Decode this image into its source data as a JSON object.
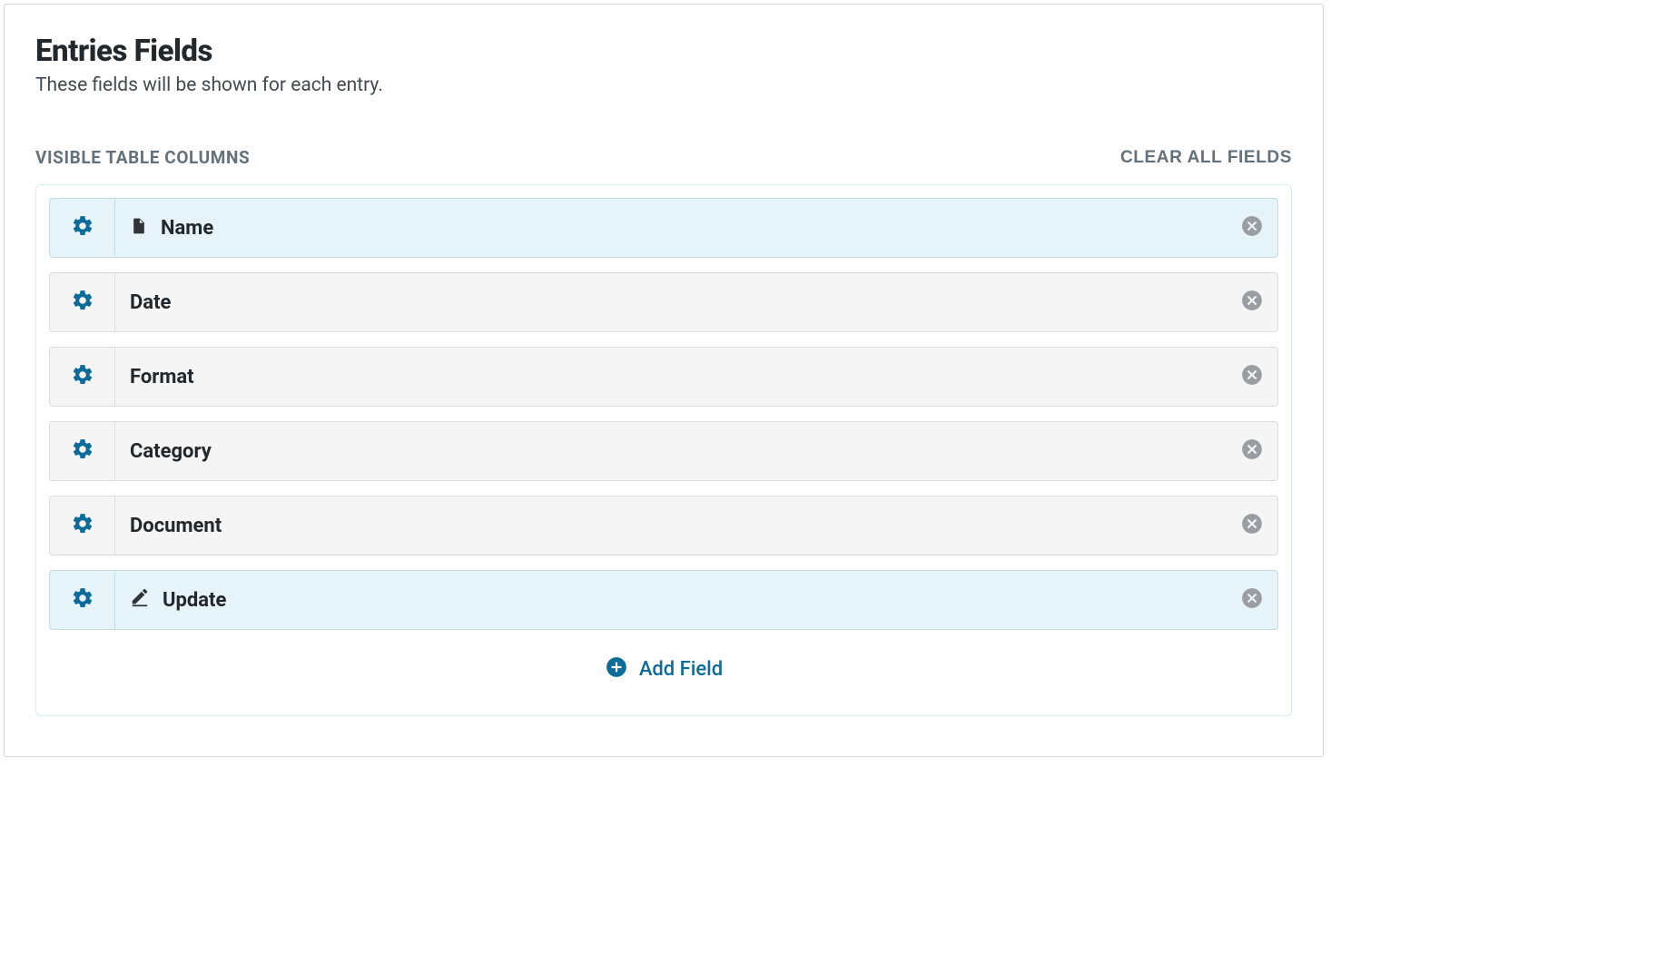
{
  "header": {
    "title": "Entries Fields",
    "description": "These fields will be shown for each entry."
  },
  "section": {
    "label": "VISIBLE TABLE COLUMNS",
    "clear_all": "CLEAR ALL FIELDS"
  },
  "fields": [
    {
      "label": "Name",
      "icon": "file-icon",
      "highlighted": true
    },
    {
      "label": "Date",
      "icon": null,
      "highlighted": false
    },
    {
      "label": "Format",
      "icon": null,
      "highlighted": false
    },
    {
      "label": "Category",
      "icon": null,
      "highlighted": false
    },
    {
      "label": "Document",
      "icon": null,
      "highlighted": false
    },
    {
      "label": "Update",
      "icon": "edit-icon",
      "highlighted": true
    }
  ],
  "add_field": {
    "label": "Add Field"
  }
}
